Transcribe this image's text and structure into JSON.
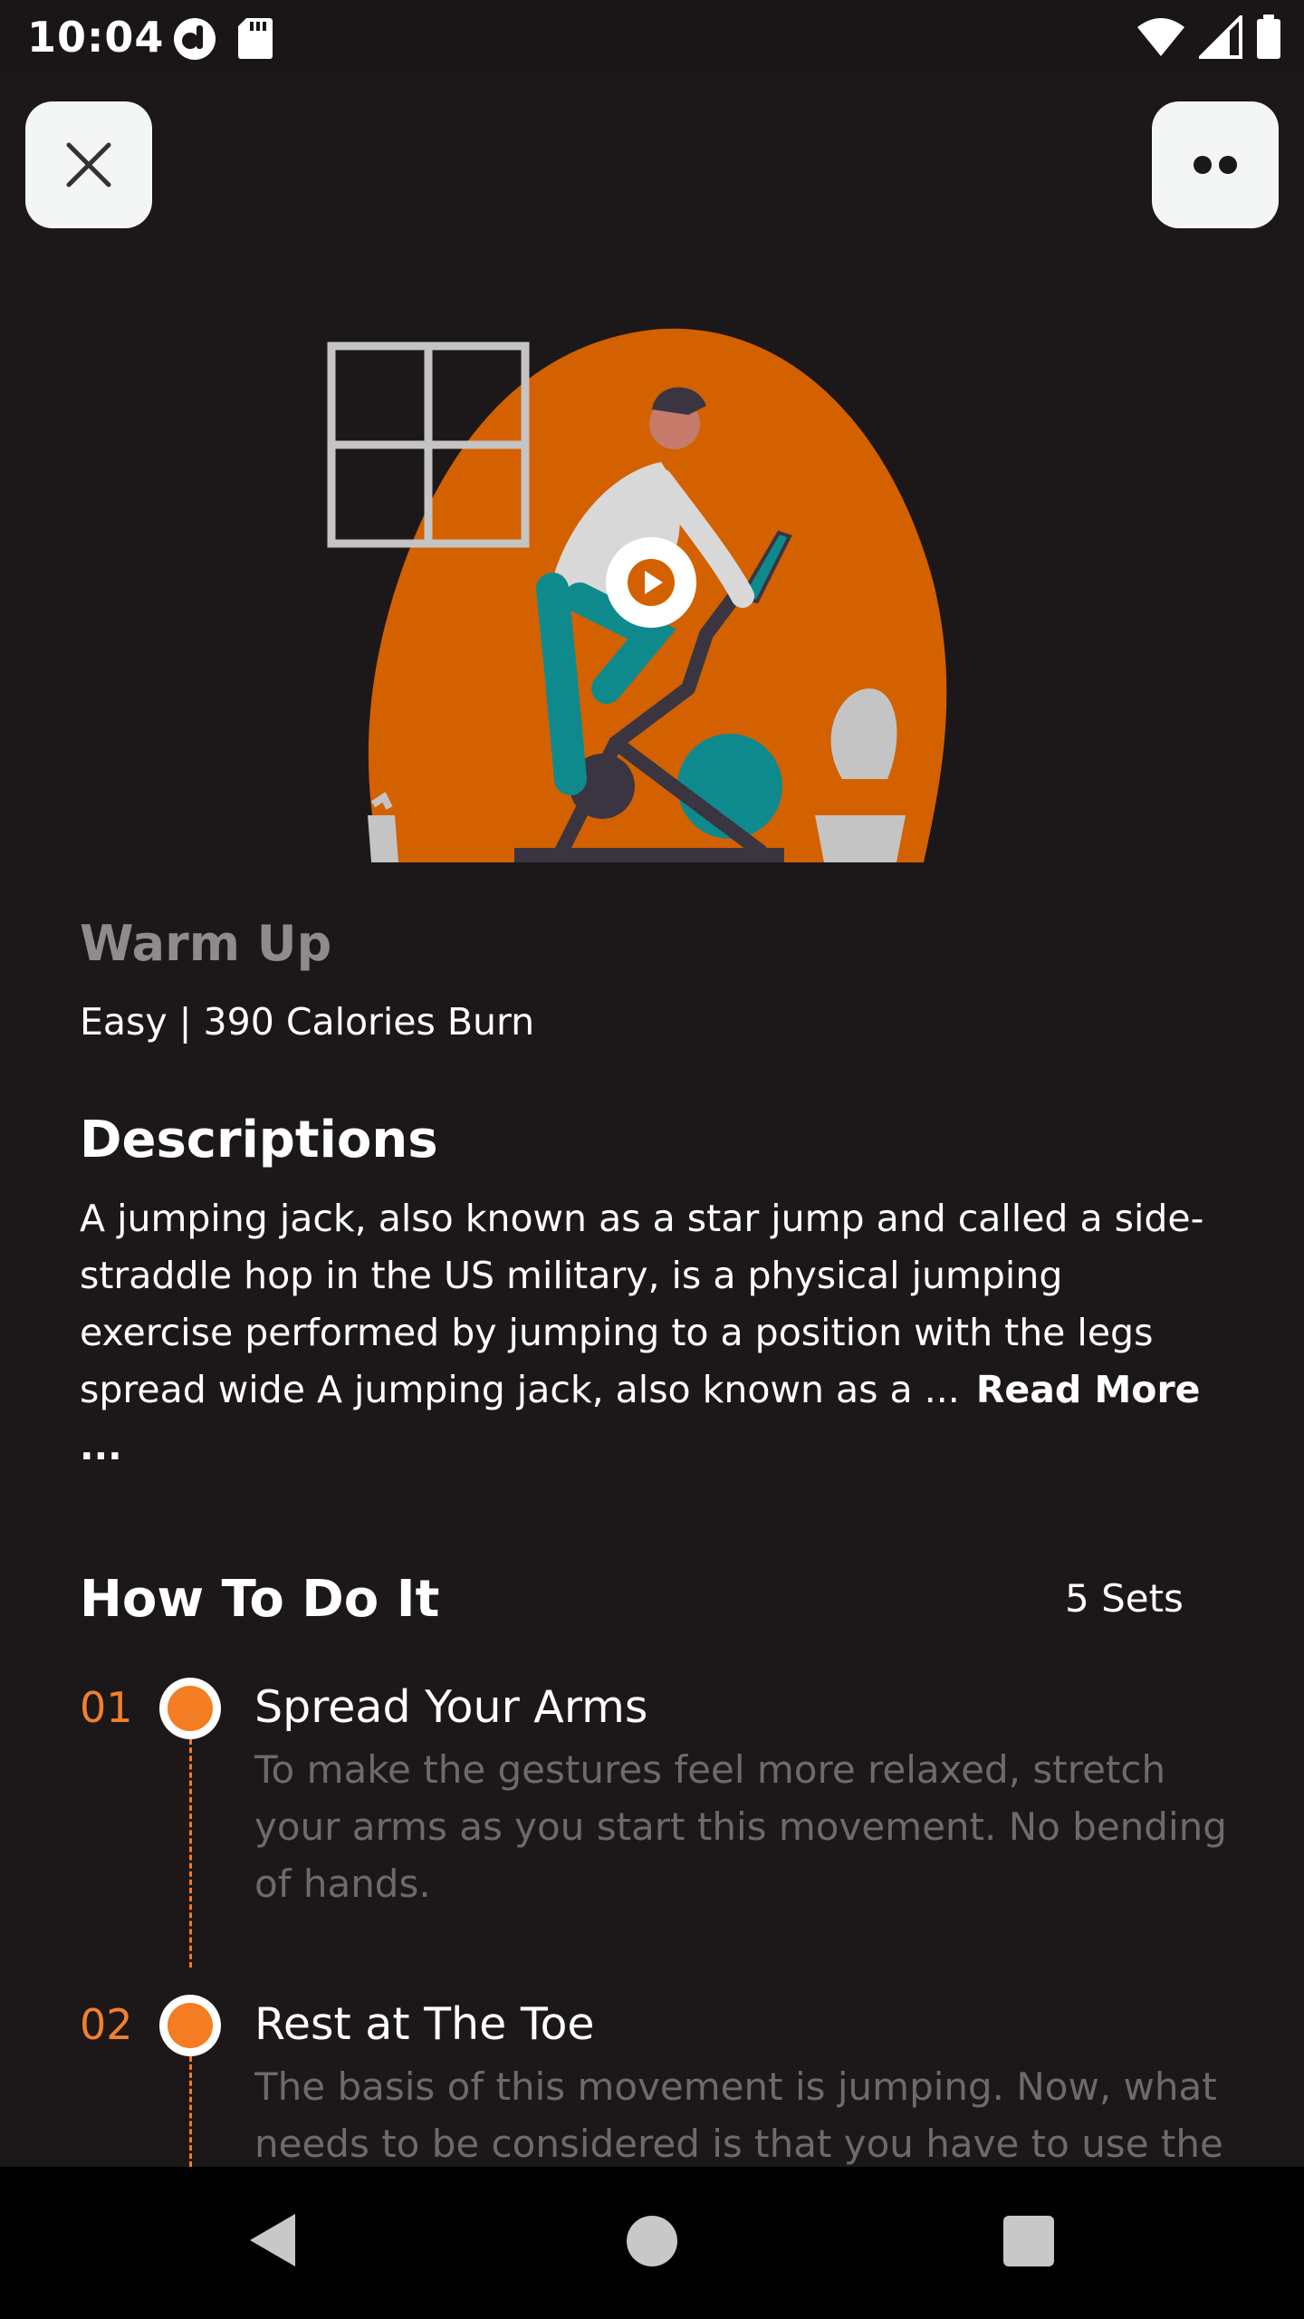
{
  "status_bar": {
    "time": "10:04",
    "icons": [
      "app-notification-icon",
      "sd-card-icon",
      "wifi-icon",
      "cell-signal-icon",
      "battery-icon"
    ]
  },
  "header": {
    "close_icon": "close-icon",
    "more_icon": "more-options-icon"
  },
  "hero": {
    "illustration": "stationary-bike-illustration",
    "play_icon": "play-icon",
    "colors": {
      "blob": "#d36100",
      "accent": "#0f8a8c",
      "dark": "#3a3540"
    }
  },
  "workout": {
    "title": "Warm Up",
    "subtitle": "Easy | 390 Calories Burn"
  },
  "descriptions": {
    "heading": "Descriptions",
    "text": "A jumping jack, also known as a star jump and called a side-straddle hop in the US military, is a physical jumping exercise performed by jumping to a position with the legs spread wide A jumping jack, also known as a ...",
    "read_more": "Read More ..."
  },
  "how_to": {
    "heading": "How To Do It",
    "sets": "5 Sets",
    "steps": [
      {
        "number": "01",
        "title": "Spread Your Arms",
        "description": "To make the gestures feel more relaxed, stretch your arms as you start this movement. No bending of hands."
      },
      {
        "number": "02",
        "title": "Rest at The Toe",
        "description": "The basis of this movement is jumping. Now, what needs to be considered is that you have to use the"
      }
    ]
  },
  "theme": {
    "background": "#1c1819",
    "accent": "#f47c22",
    "muted_text": "#6e6a6b"
  },
  "nav_bar": {
    "back_icon": "back-triangle-icon",
    "home_icon": "home-circle-icon",
    "recents_icon": "recents-square-icon"
  }
}
